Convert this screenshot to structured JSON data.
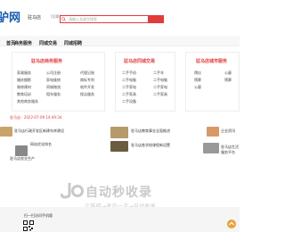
{
  "header": {
    "logo": "驴网",
    "city": "驻马店",
    "city_switch": "[切换]",
    "search_placeholder": "请输入关键字搜索"
  },
  "nav": [
    "首页",
    "商务服务",
    "同城交易",
    "同城招聘"
  ],
  "cards": [
    {
      "title": "驻马店商务服务",
      "col1": [
        "家政服务",
        "婚庆摄影",
        "装修建材",
        "教育培训",
        "其他商务服务"
      ],
      "col2": [
        "公司注册",
        "家电维修",
        "同城物流",
        "租车服务"
      ],
      "col3": [
        "代理记账",
        "商标专利",
        "软件开发",
        "保洁服务"
      ]
    },
    {
      "title": "驻马店同城交易",
      "col1": [
        "二手手机",
        "二手电脑",
        "二手家电",
        "二手家具",
        "二手设备"
      ],
      "col2": [
        "二手车",
        "二手电脑",
        "二手家电",
        "二手家具"
      ]
    },
    {
      "title": "驻马店城市服务",
      "col1": [
        "殡仪",
        "殡葬",
        "公墓"
      ],
      "col2": [
        "公墓",
        "殡葬"
      ]
    }
  ],
  "date_line": "驻马店 · 2022-07-09 14:49:34",
  "news": [
    "驻马店行政开发区新建车库建设",
    "网站优化排名",
    "驻马店教育事业全面推进",
    "驻马店各学校课程新设置",
    "企业资讯",
    "驻马店生活服务平台",
    "驻马店农业生产"
  ],
  "watermark": {
    "main": "自动秒收录",
    "sub": "让链接→来访一次→自动收录"
  },
  "footer": {
    "title": "扫一扫访问手机版"
  }
}
